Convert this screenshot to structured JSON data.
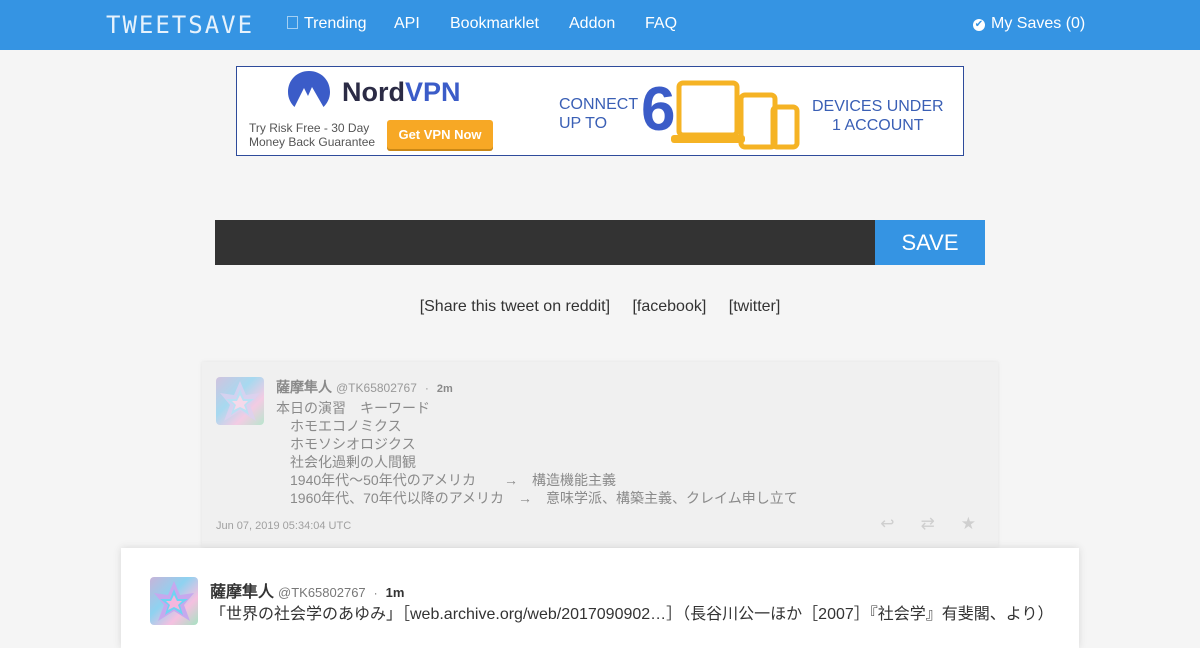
{
  "navbar": {
    "brand": "TWEETSAVE",
    "items": [
      {
        "label": "Trending",
        "icon": "trending-icon"
      },
      {
        "label": "API"
      },
      {
        "label": "Bookmarklet"
      },
      {
        "label": "Addon"
      },
      {
        "label": "FAQ"
      }
    ],
    "my_saves": "My Saves (0)",
    "color": "#3594e3"
  },
  "ad": {
    "brand_name_1": "Nord",
    "brand_name_2": "VPN",
    "tagline_1": "Try Risk Free - 30 Day",
    "tagline_2": "Money Back Guarantee",
    "button": "Get VPN Now",
    "connect_1": "CONNECT",
    "connect_2": "UP TO",
    "number": "6",
    "devices_1": "DEVICES UNDER",
    "devices_2": "1 ACCOUNT"
  },
  "save_form": {
    "input_value": "",
    "button": "SAVE"
  },
  "share": {
    "reddit": "[Share this tweet on reddit]",
    "facebook": "[facebook]",
    "twitter": "[twitter]"
  },
  "tweets": [
    {
      "name": "薩摩隼人",
      "handle": "@TK65802767",
      "dot": "·",
      "time": "2m",
      "text": "本日の演習　キーワード\n　ホモエコノミクス\n　ホモソシオロジクス\n　社会化過剰の人間観\n　1940年代～50年代のアメリカ　　→　構造機能主義\n　1960年代、70年代以降のアメリカ　→　意味学派、構築主義、クレイム申し立て",
      "date": "Jun 07, 2019 05:34:04 UTC"
    },
    {
      "name": "薩摩隼人",
      "handle": "@TK65802767",
      "dot": "·",
      "time": "1m",
      "text": "「世界の社会学のあゆみ」［web.archive.org/web/2017090902…］（長谷川公一ほか［2007］『社会学』有斐閣、より）"
    }
  ]
}
